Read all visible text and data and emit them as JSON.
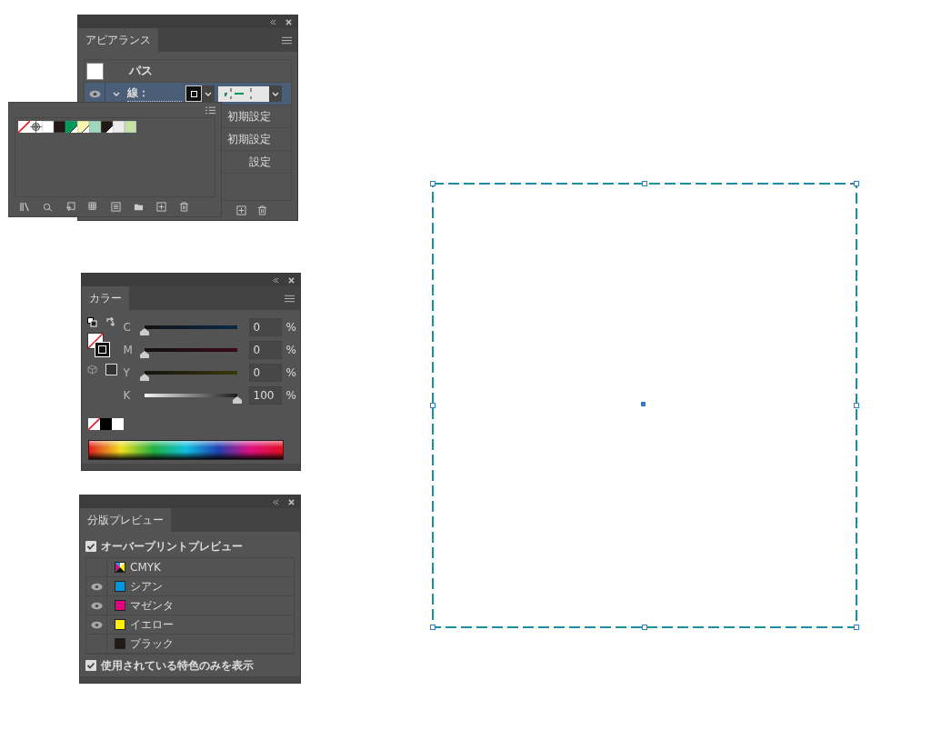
{
  "appearance_panel": {
    "tab": "アピアランス",
    "object_label": "パス",
    "stroke": {
      "label": "線：",
      "visible": true,
      "selected": true
    },
    "rows": [
      {
        "label": "初期設定"
      },
      {
        "label": "初期設定"
      },
      {
        "label": "設定"
      }
    ]
  },
  "swatches_popup": {
    "swatches": [
      {
        "kind": "none"
      },
      {
        "kind": "registration"
      },
      {
        "kind": "color",
        "color": "#ffffff",
        "corner": false
      },
      {
        "kind": "color",
        "color": "#231815",
        "corner": false
      },
      {
        "kind": "color",
        "color": "#00995a",
        "corner": true
      },
      {
        "kind": "color",
        "color": "#fdf5b0",
        "corner": true
      },
      {
        "kind": "color",
        "color": "#9fd6bd",
        "corner": false
      },
      {
        "kind": "color",
        "color": "#231815",
        "corner": true
      },
      {
        "kind": "color",
        "color": "#ececec",
        "corner": false
      },
      {
        "kind": "color",
        "color": "#c5e3a8",
        "corner": false
      }
    ]
  },
  "color_panel": {
    "tab": "カラー",
    "channels": [
      {
        "name": "C",
        "level": 0,
        "value": "0",
        "unit": "%"
      },
      {
        "name": "M",
        "level": 0,
        "value": "0",
        "unit": "%"
      },
      {
        "name": "Y",
        "level": 0,
        "value": "0",
        "unit": "%"
      },
      {
        "name": "K",
        "level": 1,
        "value": "100",
        "unit": "%"
      }
    ]
  },
  "separations_panel": {
    "tab": "分版プレビュー",
    "overprint": {
      "label": "オーバープリントプレビュー",
      "checked": true
    },
    "plates": [
      {
        "name": "CMYK",
        "kind": "composite",
        "visible": false
      },
      {
        "name": "シアン",
        "kind": "plate",
        "visible": true,
        "color": "#0097db"
      },
      {
        "name": "マゼンタ",
        "kind": "plate",
        "visible": true,
        "color": "#e4007f"
      },
      {
        "name": "イエロー",
        "kind": "plate",
        "visible": true,
        "color": "#fff100"
      },
      {
        "name": "ブラック",
        "kind": "plate",
        "visible": false,
        "color": "#231815"
      }
    ],
    "spot_only": {
      "label": "使用されている特色のみを表示",
      "checked": true
    }
  },
  "canvas": {
    "selected": true
  }
}
